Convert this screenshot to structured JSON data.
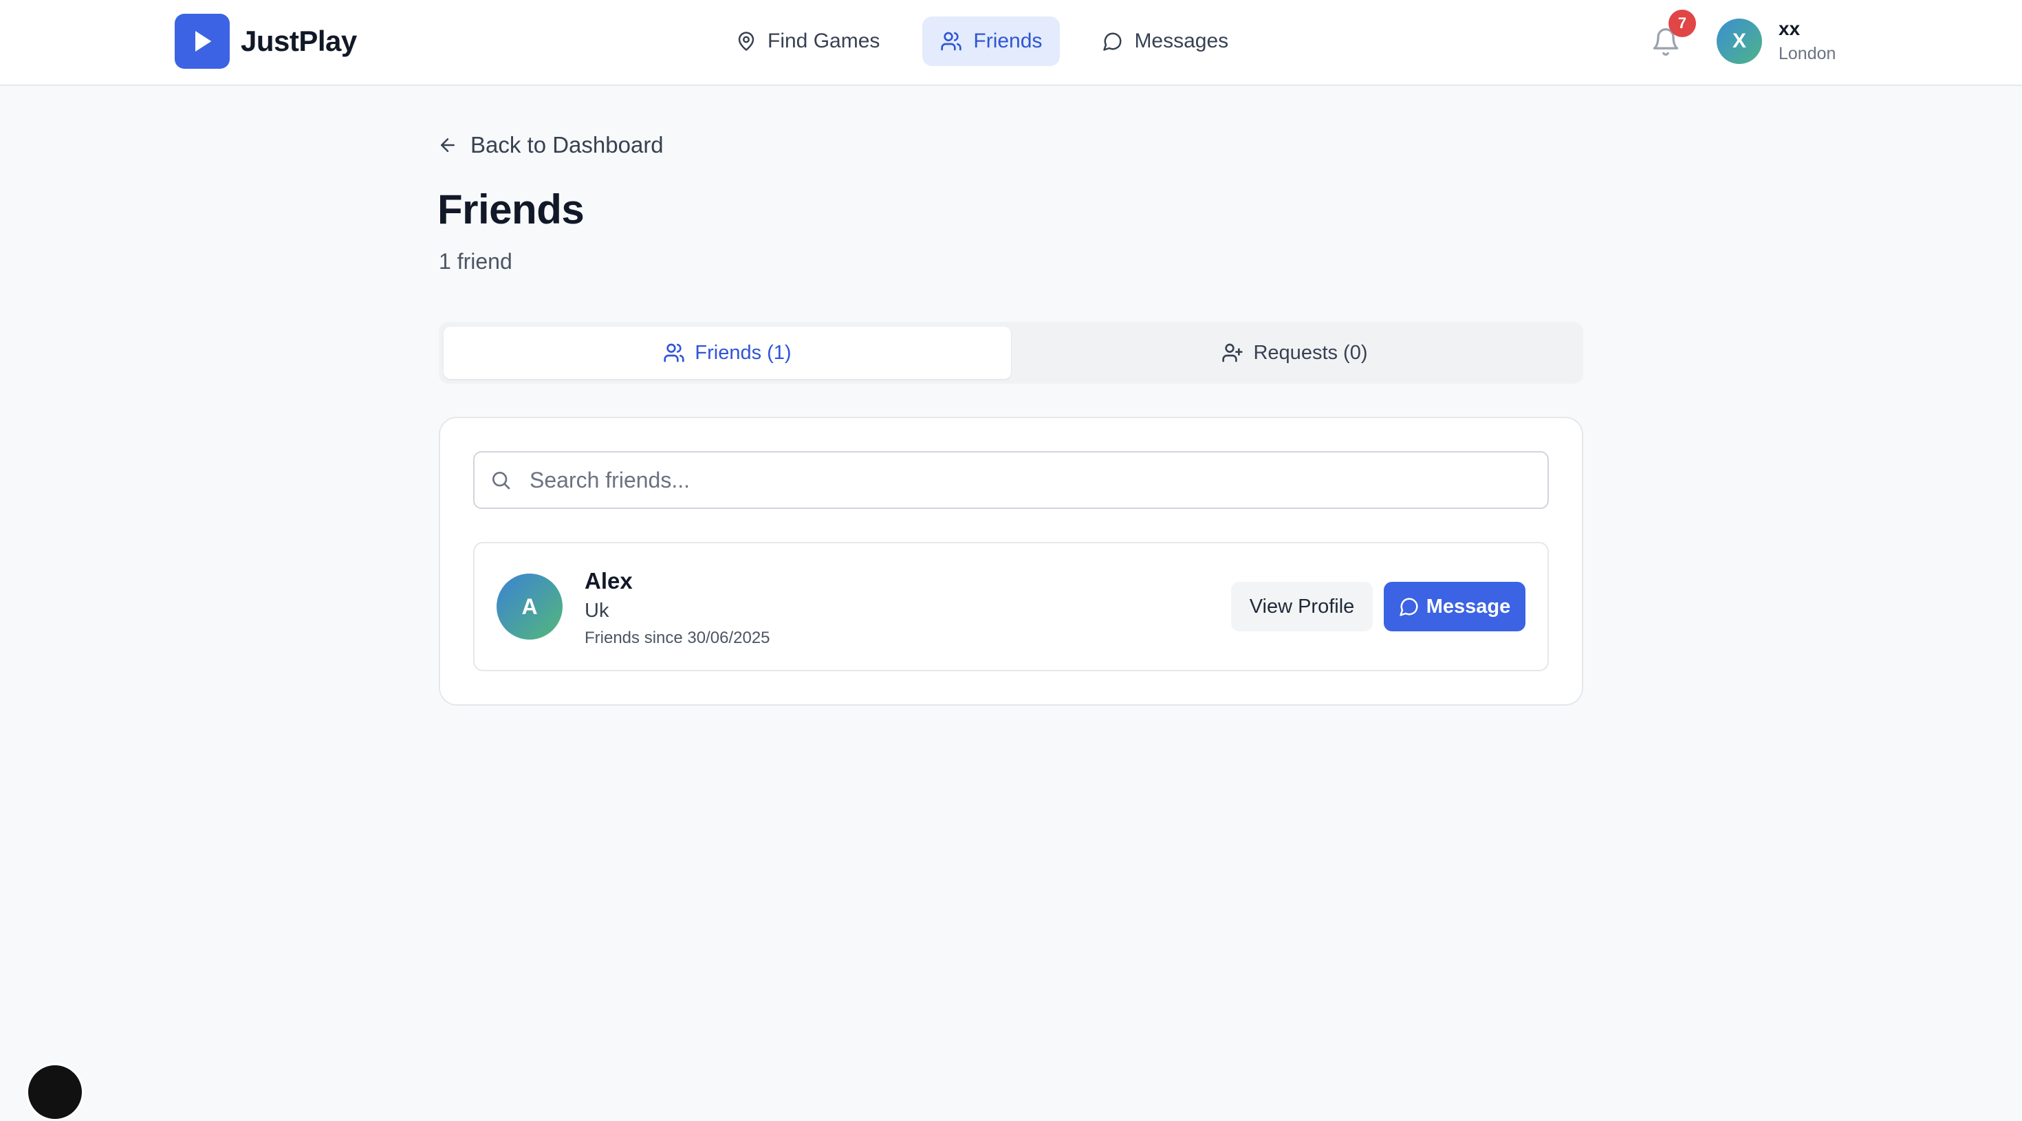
{
  "app": {
    "name": "JustPlay",
    "brand_color": "#3b63e3"
  },
  "nav": {
    "items": [
      {
        "label": "Find Games",
        "icon": "map-pin-icon",
        "active": false
      },
      {
        "label": "Friends",
        "icon": "users-icon",
        "active": true
      },
      {
        "label": "Messages",
        "icon": "message-circle-icon",
        "active": false
      }
    ]
  },
  "notifications": {
    "count": "7",
    "icon": "bell-icon"
  },
  "user": {
    "initial": "X",
    "name": "xx",
    "location": "London"
  },
  "page": {
    "back_label": "Back to Dashboard",
    "title": "Friends",
    "subtitle": "1 friend"
  },
  "tabs": [
    {
      "label": "Friends (1)",
      "icon": "users-icon",
      "active": true
    },
    {
      "label": "Requests (0)",
      "icon": "user-plus-icon",
      "active": false
    }
  ],
  "search": {
    "placeholder": "Search friends...",
    "value": ""
  },
  "friends": [
    {
      "initial": "A",
      "name": "Alex",
      "location": "Uk",
      "since": "Friends since 30/06/2025",
      "view_label": "View Profile",
      "message_label": "Message"
    }
  ],
  "colors": {
    "active_text": "#2f55d4",
    "active_bg": "#e3ebfc",
    "badge": "#e04646"
  }
}
